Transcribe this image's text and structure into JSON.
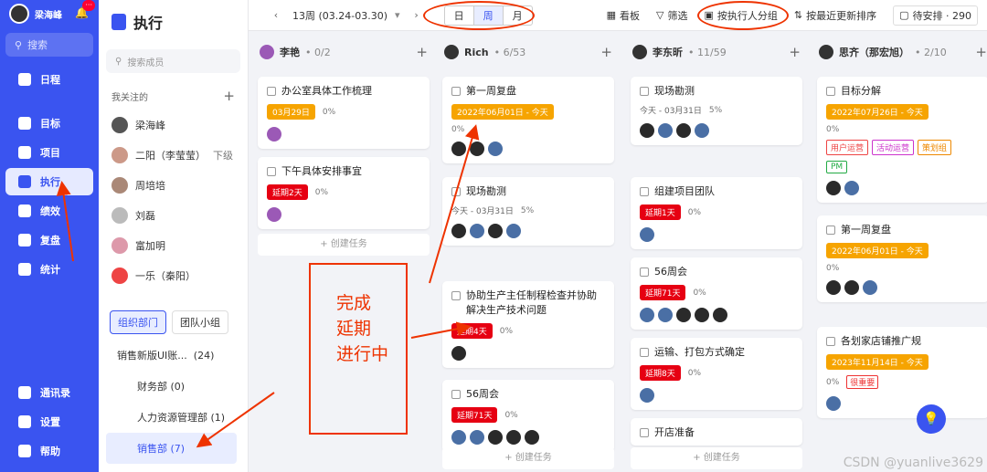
{
  "nav": {
    "user": "梁海峰",
    "badge": "···",
    "search": "搜索",
    "items": [
      "日程",
      "目标",
      "项目",
      "执行",
      "绩效",
      "复盘",
      "统计"
    ],
    "bottom": [
      "通讯录",
      "设置",
      "帮助"
    ]
  },
  "side": {
    "title": "执行",
    "search_placeholder": "搜索成员",
    "follow_label": "我关注的",
    "members": [
      {
        "name": "梁海峰",
        "extra": ""
      },
      {
        "name": "二阳（李莹莹）",
        "extra": "下级"
      },
      {
        "name": "周培培",
        "extra": ""
      },
      {
        "name": "刘磊",
        "extra": ""
      },
      {
        "name": "富加明",
        "extra": ""
      },
      {
        "name": "一乐（秦阳）",
        "extra": ""
      }
    ],
    "tabs": [
      "组织部门",
      "团队小组"
    ],
    "org": "销售新版UI账...",
    "org_count": "(24)",
    "depts": [
      "财务部 (0)",
      "人力资源管理部 (1)",
      "销售部 (7)"
    ]
  },
  "topbar": {
    "week": "13周 (03.24-03.30)",
    "seg": [
      "日",
      "周",
      "月"
    ],
    "kanban": "看板",
    "filter": "筛选",
    "group": "按执行人分组",
    "sort": "按最近更新排序",
    "pending": "待安排 · 290"
  },
  "columns": [
    {
      "name": "李艳",
      "count": "0/2"
    },
    {
      "name": "Rich",
      "count": "6/53"
    },
    {
      "name": "李东昕",
      "count": "11/59"
    },
    {
      "name": "思齐（那宏旭）",
      "count": "2/10"
    }
  ],
  "cards": {
    "c1": {
      "title": "办公室具体工作梳理",
      "date": "03月29日",
      "prog": "0%"
    },
    "c2": {
      "title": "下午具体安排事宜",
      "date": "延期2天",
      "prog": "0%"
    },
    "c3": {
      "title": "第一周复盘",
      "date": "2022年06月01日 - 今天",
      "prog": "0%"
    },
    "c4": {
      "title": "现场勘测",
      "date": "今天 - 03月31日",
      "prog": "5%"
    },
    "c5": {
      "title": "协助生产主任制程检查并协助解决生产技术问题",
      "date": "延期4天",
      "prog": "0%"
    },
    "c6": {
      "title": "56周会",
      "date": "延期71天",
      "prog": "0%"
    },
    "c7": {
      "title": "现场勘测",
      "date": "今天 - 03月31日",
      "prog": "5%"
    },
    "c8": {
      "title": "组建项目团队",
      "date": "延期1天",
      "prog": "0%"
    },
    "c9": {
      "title": "56周会",
      "date": "延期71天",
      "prog": "0%"
    },
    "c10": {
      "title": "运输、打包方式确定",
      "date": "延期8天",
      "prog": "0%"
    },
    "c11": {
      "title": "开店准备",
      "date": "",
      "prog": ""
    },
    "c12": {
      "title": "目标分解",
      "date": "2022年07月26日 - 今天",
      "prog": "0%",
      "labels": [
        "用户运营",
        "活动运营",
        "策划组",
        "PM"
      ]
    },
    "c13": {
      "title": "第一周复盘",
      "date": "2022年06月01日 - 今天",
      "prog": "0%"
    },
    "c14": {
      "title": "各划家店铺推广规",
      "date": "2023年11月14日 - 今天",
      "prog": "0%",
      "label": "很重要"
    }
  },
  "create_label": "创建任务",
  "annotation": [
    "完成",
    "延期",
    "进行中"
  ],
  "watermark": "CSDN @yuanlive3629"
}
